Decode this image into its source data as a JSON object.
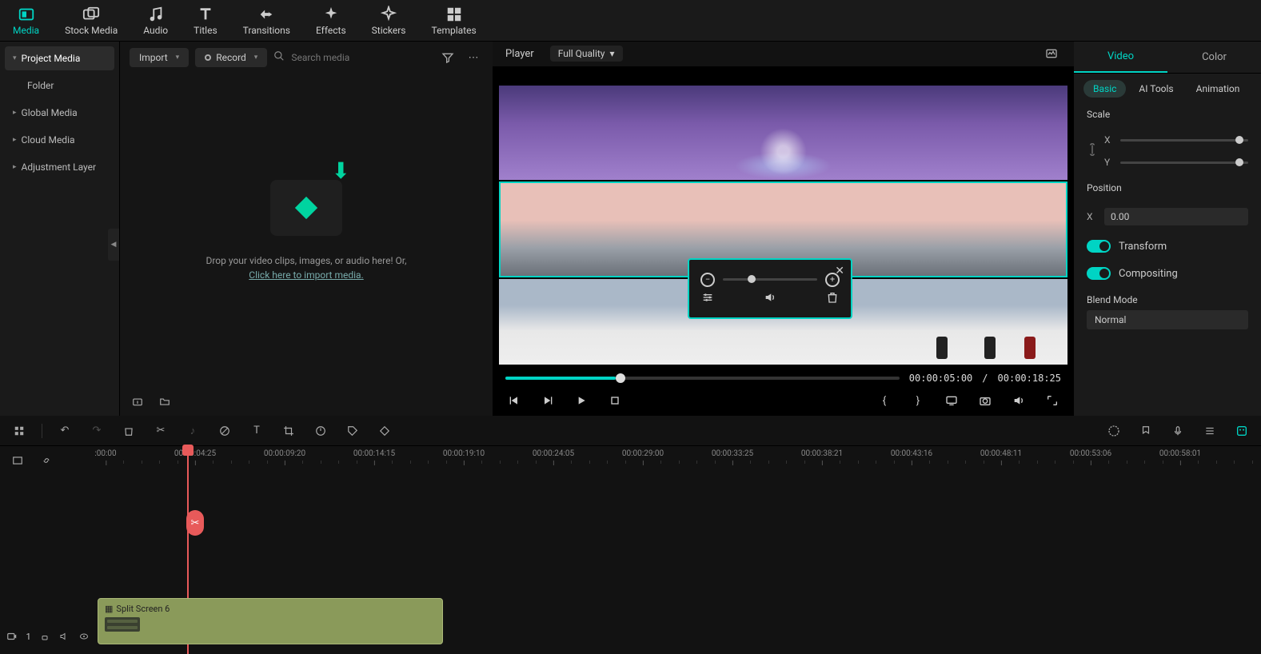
{
  "nav": {
    "media": "Media",
    "stock": "Stock Media",
    "audio": "Audio",
    "titles": "Titles",
    "transitions": "Transitions",
    "effects": "Effects",
    "stickers": "Stickers",
    "templates": "Templates"
  },
  "sidebar": {
    "project": "Project Media",
    "folder": "Folder",
    "global": "Global Media",
    "cloud": "Cloud Media",
    "adjust": "Adjustment Layer"
  },
  "midbar": {
    "import": "Import",
    "record": "Record",
    "search_placeholder": "Search media"
  },
  "drop": {
    "line1": "Drop your video clips, images, or audio here! Or,",
    "link": "Click here to import media."
  },
  "player": {
    "label": "Player",
    "quality": "Full Quality",
    "time_cur": "00:00:05:00",
    "time_sep": "/",
    "time_total": "00:00:18:25"
  },
  "inspector": {
    "tab_video": "Video",
    "tab_color": "Color",
    "sub_basic": "Basic",
    "sub_ai": "AI Tools",
    "sub_anim": "Animation",
    "scale": "Scale",
    "axis_x": "X",
    "axis_y": "Y",
    "position": "Position",
    "pos_x_val": "0.00",
    "transform": "Transform",
    "compositing": "Compositing",
    "blend_label": "Blend Mode",
    "blend_value": "Normal"
  },
  "timeline": {
    "ticks": [
      ":00:00",
      "00:00:04:25",
      "00:00:09:20",
      "00:00:14:15",
      "00:00:19:10",
      "00:00:24:05",
      "00:00:29:00",
      "00:00:33:25",
      "00:00:38:21",
      "00:00:43:16",
      "00:00:48:11",
      "00:00:53:06",
      "00:00:58:01"
    ],
    "clip_name": "Split Screen 6",
    "track_index": "1"
  }
}
